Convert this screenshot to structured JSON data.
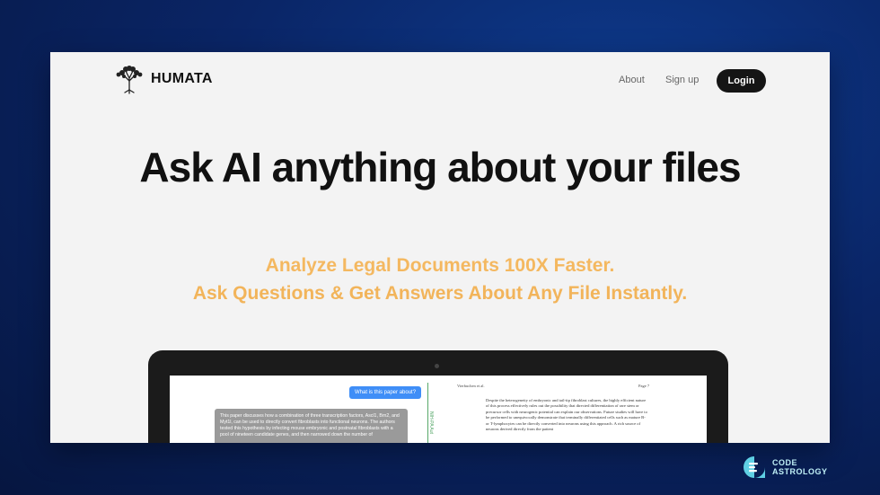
{
  "nav": {
    "brand": "HUMATA",
    "about": "About",
    "signup": "Sign up",
    "login": "Login"
  },
  "hero": {
    "title": "Ask AI anything about your files",
    "subtitle_1": "Analyze Legal Documents 100X Faster.",
    "subtitle_2": "Ask Questions & Get Answers About Any File Instantly."
  },
  "demo": {
    "question": "What is this paper about?",
    "answer": "This paper discusses how a combination of three transcription factors, Ascl1, Brn2, and Myt1l, can be used to directly convert fibroblasts into functional neurons. The authors tested this hypothesis by infecting mouse embryonic and postnatal fibroblasts with a pool of nineteen candidate genes, and then narrowed down the number of",
    "doc_header_left": "Vierbuchen et al.",
    "doc_header_right": "Page 7",
    "vertical_label": "NIH-PA Aut",
    "doc_text": "Despite the heterogeneity of embryonic and tail-tip fibroblast cultures, the highly efficient nature of this process effectively rules out the possibility that directed differentiation of rare stem or precursor cells with neurogenic potential can explain our observations. Future studies will have to be performed to unequivocally demonstrate that terminally differentiated cells such as mature B- or T-lymphocytes can be directly converted into neurons using this approach. A rich source of neurons derived directly from the patient"
  },
  "watermark": {
    "line1": "CODE",
    "line2": "ASTROLOGY"
  },
  "colors": {
    "background": "#0a2566",
    "page": "#f3f3f3",
    "accent_orange": "#f4b860",
    "login_button": "#151515",
    "chat_blue": "#3f8ef7",
    "watermark_teal": "#bfeff6"
  }
}
